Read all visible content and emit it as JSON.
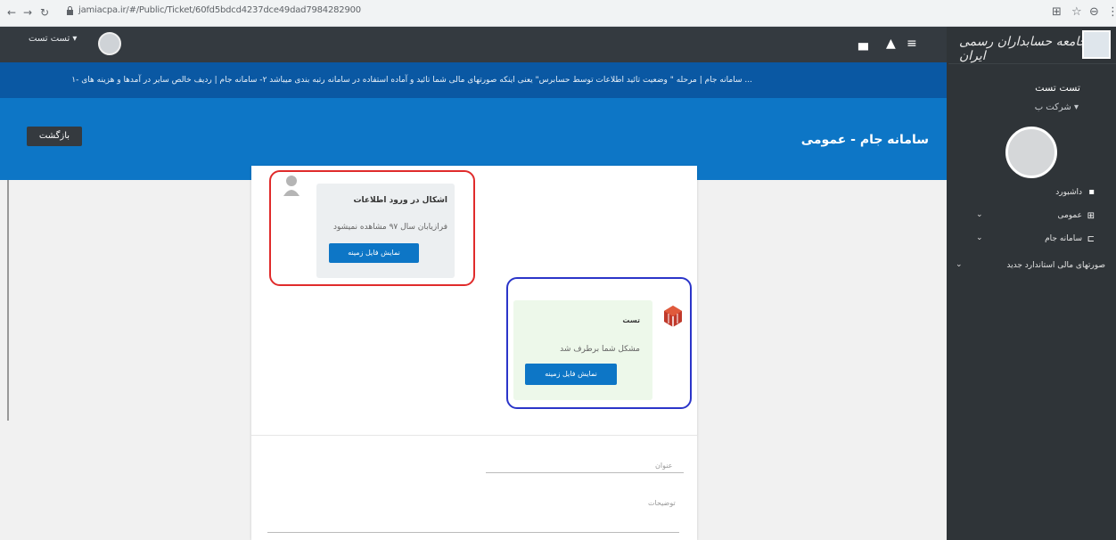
{
  "browser": {
    "url": "jamiacpa.ir/#/Public/Ticket/60fd5bdcd4237dce49dad7984282900",
    "nav_back": "←",
    "nav_forward": "→",
    "nav_reload": "↻",
    "icons": [
      "translate-icon",
      "star-icon",
      "account-icon",
      "menu-icon"
    ]
  },
  "topbar": {
    "user_label": "تست تست ▾",
    "icons": [
      "chat-icon",
      "bell-icon",
      "hamburger-icon"
    ]
  },
  "sidebar": {
    "logo_text": "جامعه حسابداران رسمی ایران",
    "user_name": "تست تست",
    "company": "شرکت ب ▾",
    "items": [
      {
        "label": "داشبورد",
        "icon": "dashboard-icon",
        "expand": false
      },
      {
        "label": "عمومی",
        "icon": "general-icon",
        "expand": true
      },
      {
        "label": "سامانه جام",
        "icon": "jam-icon",
        "expand": true
      },
      {
        "label": "صورتهای مالی استاندارد جدید",
        "icon": "",
        "expand": true
      }
    ]
  },
  "marquee": {
    "text": "۱- سامانه جام | مرحله \" وضعیت تائید اطلاعات توسط حسابرس\" یعنی اینکه صورتهای مالی شما تائید و آماده استفاده در سامانه رتبه بندی میباشد ۲- سامانه جام | ردیف خالص سایر در آمدها و هزینه های ..."
  },
  "page": {
    "title": "سامانه جام - عمومی",
    "back_label": "بازگشت"
  },
  "messages": [
    {
      "title": "اشکال در ورود اطلاعات",
      "body": "فرازیابان سال ۹۷ مشاهده نمیشود",
      "button": "نمایش فایل زمینه"
    },
    {
      "title": "تست",
      "body": "مشکل شما برطرف شد",
      "button": "نمایش فایل زمینه"
    }
  ],
  "form": {
    "title_label": "عنوان",
    "desc_label": "توضیحات"
  },
  "colors": {
    "primary": "#0d76c6",
    "dark_nav": "#343a40",
    "sidebar": "#2f3438",
    "red_highlight": "#e02b2b",
    "blue_highlight": "#2b35c9"
  }
}
